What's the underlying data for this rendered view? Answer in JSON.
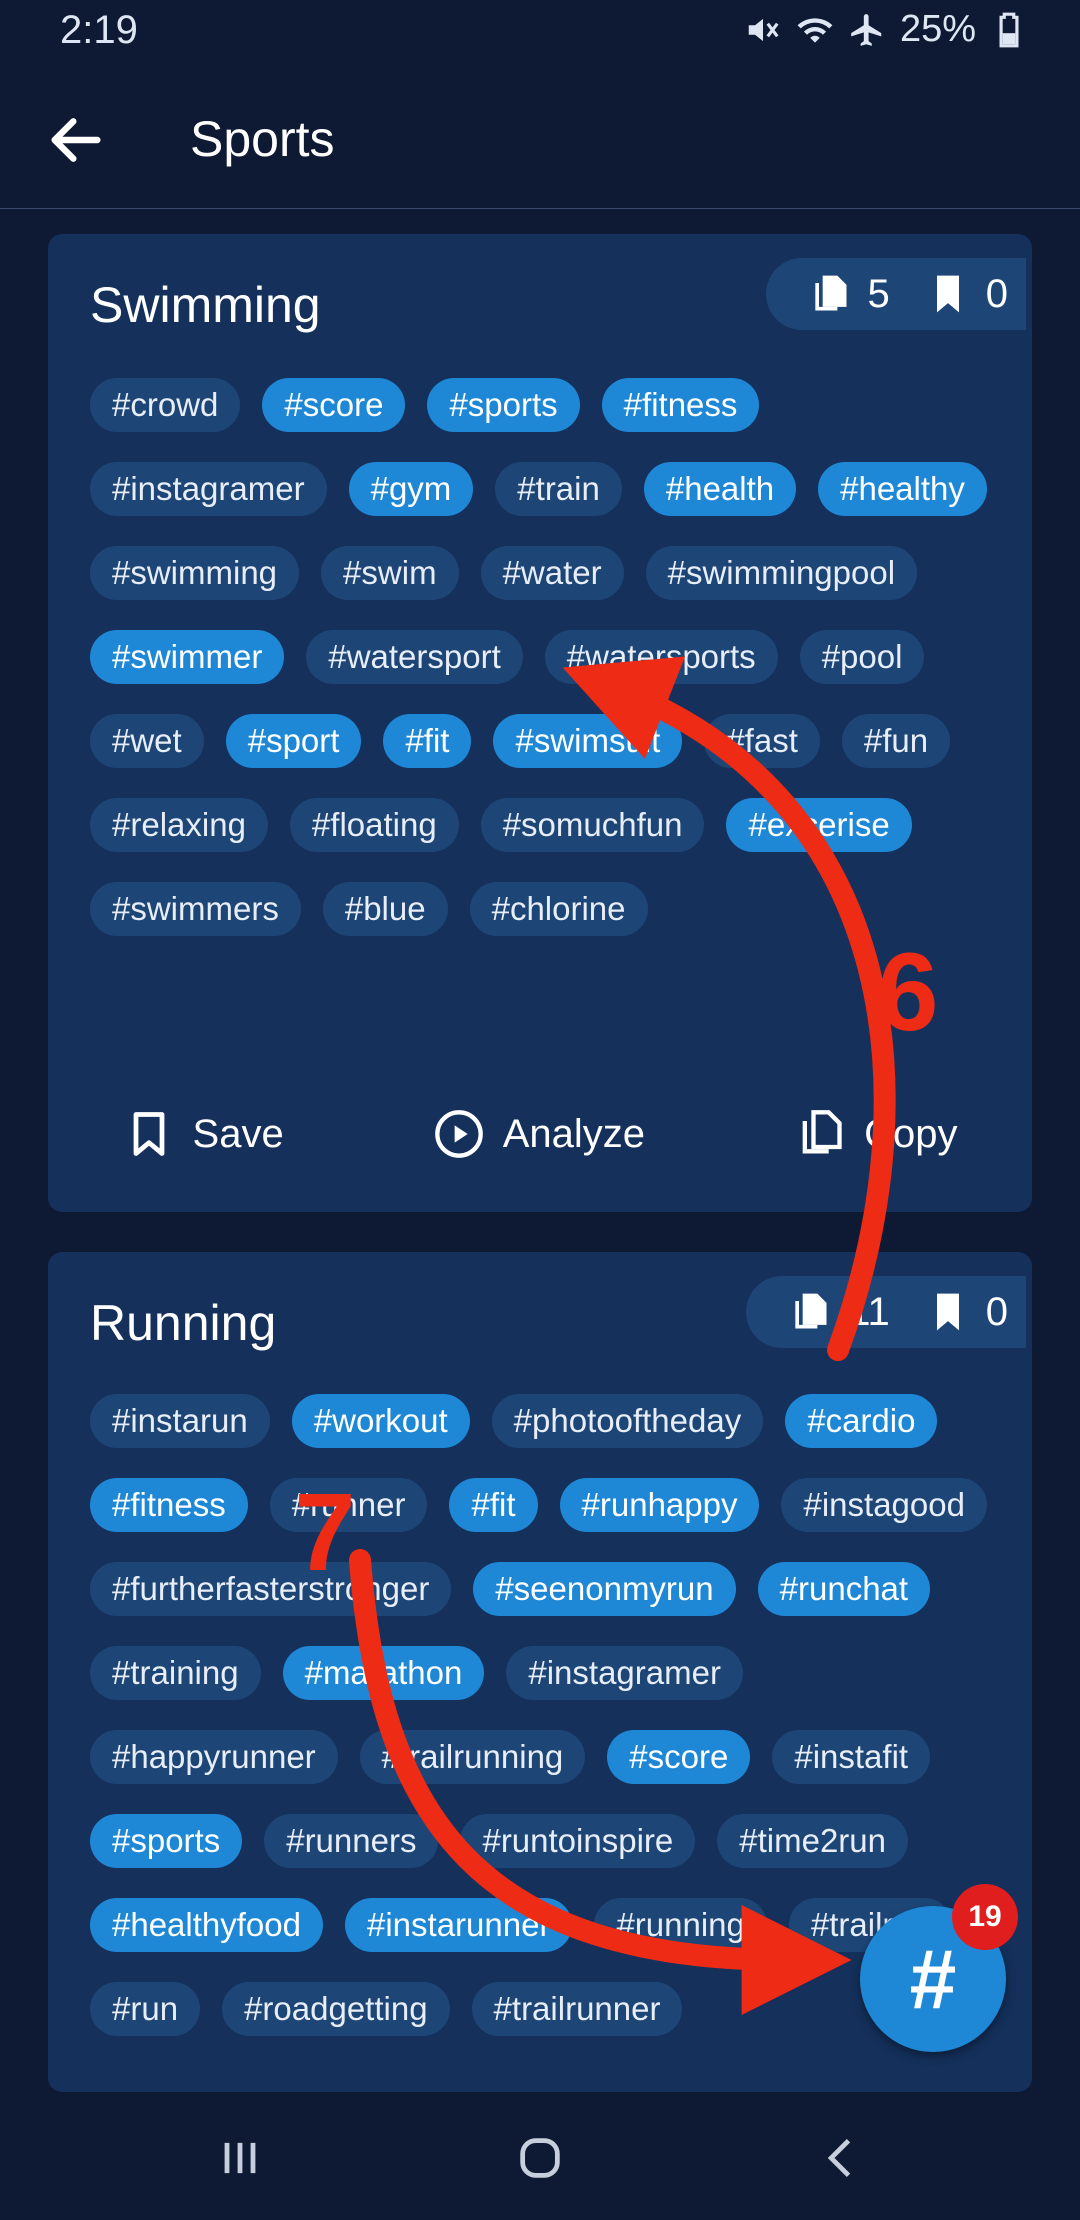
{
  "status_bar": {
    "time": "2:19",
    "battery": "25%"
  },
  "app_bar": {
    "title": "Sports"
  },
  "cards": [
    {
      "title": "Swimming",
      "copies": "5",
      "saves": "0",
      "tags": [
        {
          "text": "#crowd",
          "on": false
        },
        {
          "text": "#score",
          "on": true
        },
        {
          "text": "#sports",
          "on": true
        },
        {
          "text": "#fitness",
          "on": true
        },
        {
          "text": "#instagramer",
          "on": false
        },
        {
          "text": "#gym",
          "on": true
        },
        {
          "text": "#train",
          "on": false
        },
        {
          "text": "#health",
          "on": true
        },
        {
          "text": "#healthy",
          "on": true
        },
        {
          "text": "#swimming",
          "on": false
        },
        {
          "text": "#swim",
          "on": false
        },
        {
          "text": "#water",
          "on": false
        },
        {
          "text": "#swimmingpool",
          "on": false
        },
        {
          "text": "#swimmer",
          "on": true
        },
        {
          "text": "#watersport",
          "on": false
        },
        {
          "text": "#watersports",
          "on": false
        },
        {
          "text": "#pool",
          "on": false
        },
        {
          "text": "#wet",
          "on": false
        },
        {
          "text": "#sport",
          "on": true
        },
        {
          "text": "#fit",
          "on": true
        },
        {
          "text": "#swimsuit",
          "on": true
        },
        {
          "text": "#fast",
          "on": false
        },
        {
          "text": "#fun",
          "on": false
        },
        {
          "text": "#relaxing",
          "on": false
        },
        {
          "text": "#floating",
          "on": false
        },
        {
          "text": "#somuchfun",
          "on": false
        },
        {
          "text": "#excerise",
          "on": true
        },
        {
          "text": "#swimmers",
          "on": false
        },
        {
          "text": "#blue",
          "on": false
        },
        {
          "text": "#chlorine",
          "on": false
        }
      ],
      "actions": {
        "save": "Save",
        "analyze": "Analyze",
        "copy": "Copy"
      }
    },
    {
      "title": "Running",
      "copies": "11",
      "saves": "0",
      "tags": [
        {
          "text": "#instarun",
          "on": false
        },
        {
          "text": "#workout",
          "on": true
        },
        {
          "text": "#photooftheday",
          "on": false
        },
        {
          "text": "#cardio",
          "on": true
        },
        {
          "text": "#fitness",
          "on": true
        },
        {
          "text": "#runner",
          "on": false
        },
        {
          "text": "#fit",
          "on": true
        },
        {
          "text": "#runhappy",
          "on": true
        },
        {
          "text": "#instagood",
          "on": false
        },
        {
          "text": "#furtherfasterstronger",
          "on": false
        },
        {
          "text": "#seenonmyrun",
          "on": true
        },
        {
          "text": "#runchat",
          "on": true
        },
        {
          "text": "#training",
          "on": false
        },
        {
          "text": "#marathon",
          "on": true
        },
        {
          "text": "#instagramer",
          "on": false
        },
        {
          "text": "#happyrunner",
          "on": false
        },
        {
          "text": "#trailrunning",
          "on": false
        },
        {
          "text": "#score",
          "on": true
        },
        {
          "text": "#instafit",
          "on": false
        },
        {
          "text": "#sports",
          "on": true
        },
        {
          "text": "#runners",
          "on": false
        },
        {
          "text": "#runtoinspire",
          "on": false
        },
        {
          "text": "#time2run",
          "on": false
        },
        {
          "text": "#healthyfood",
          "on": true
        },
        {
          "text": "#instarunner",
          "on": true
        },
        {
          "text": "#running",
          "on": false
        },
        {
          "text": "#trailrun",
          "on": false
        },
        {
          "text": "#run",
          "on": false
        },
        {
          "text": "#roadgetting",
          "on": false
        },
        {
          "text": "#trailrunner",
          "on": false
        }
      ]
    }
  ],
  "fab": {
    "label": "#",
    "badge": "19"
  },
  "annotations": {
    "first": "6",
    "second": "7",
    "color": "#ee2b14"
  },
  "colors": {
    "background": "#0e1a33",
    "card": "#14305b",
    "chip": "#1d4677",
    "chip_active": "#1e88d6"
  }
}
